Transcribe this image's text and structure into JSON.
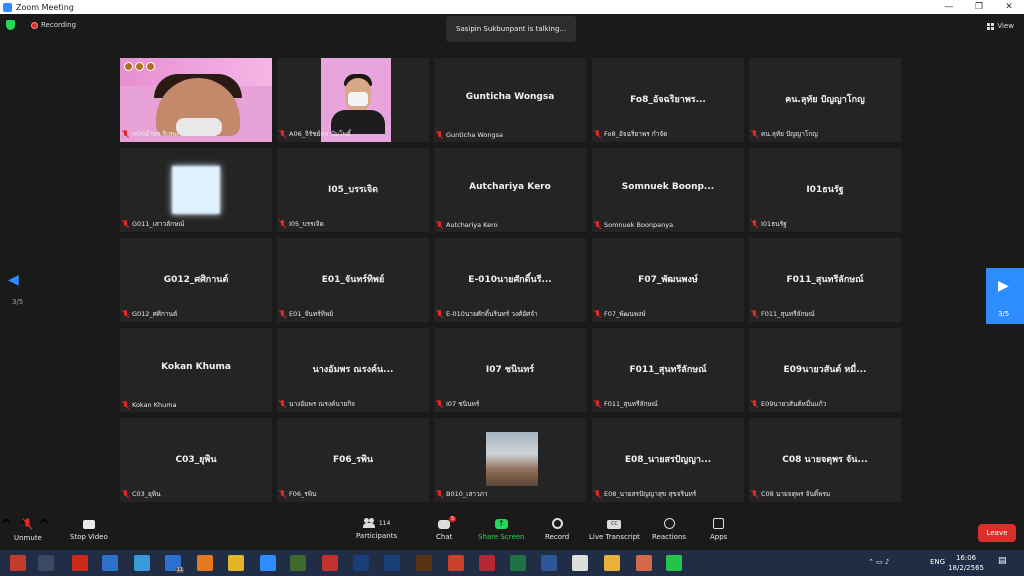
{
  "window": {
    "title": "Zoom Meeting"
  },
  "top": {
    "recording": "Recording",
    "talking": "Sasipin Sukbunpant is talking...",
    "view": "View"
  },
  "pager": {
    "left_page": "3/5",
    "right_page": "3/5"
  },
  "tiles": [
    {
      "name": "",
      "label": "H06อำพร ริเสพภัณีน์",
      "video": "woman"
    },
    {
      "name": "",
      "label": "A06_จิรัชย์ศล ปัมโพธิ์",
      "video": "man"
    },
    {
      "name": "Gunticha Wongsa",
      "label": "Gunticha Wongsa"
    },
    {
      "name": "Fo8_อัจฉริยาพร...",
      "label": "Fo8_อัจฉริยาพร กำจัด"
    },
    {
      "name": "ฅน.ลุทัย ปัญญาโกญ",
      "label": "ฅน.ลุทัย ปัญญาโกญ"
    },
    {
      "name": "",
      "label": "G011_เสาวลักษณ์",
      "video": "avatar"
    },
    {
      "name": "I05_บรรเจิด",
      "label": "I05_บรรเจิด"
    },
    {
      "name": "Autchariya Kero",
      "label": "Autchariya Kero"
    },
    {
      "name": "Somnuek Boonp...",
      "label": "Somnuek Boonpanya"
    },
    {
      "name": "I01ธนรัฐ",
      "label": "I01ธนรัฐ"
    },
    {
      "name": "G012_ศศิกานต์",
      "label": "G012_ศศิกานต์"
    },
    {
      "name": "E01_จันทร์ทิพย์",
      "label": "E01_จันทร์ทิพย์"
    },
    {
      "name": "E-010นายศักดิ์นรี...",
      "label": "E-010นายศักดิ์นรินทร์ วงศ์อัศจำ"
    },
    {
      "name": "F07_พัฒนพงษ์",
      "label": "F07_พัฒนพงษ์"
    },
    {
      "name": "F011_สุนทรีลักษณ์",
      "label": "F011_สุนทรีลักษณ์"
    },
    {
      "name": "Kokan Khuma",
      "label": "Kokan Khuma"
    },
    {
      "name": "นางอัมพร ณรงค์น...",
      "label": "นางอัมพร ณรงค์นายกิจ"
    },
    {
      "name": "I07 ชนินทร์",
      "label": "I07 ชนินทร์"
    },
    {
      "name": "F011_สุนทรีลักษณ์",
      "label": "F011_สุนทรีลักษณ์"
    },
    {
      "name": "E09นายวสันต์ หมื่...",
      "label": "E09นายวสันต์หมื่นแก้ว"
    },
    {
      "name": "C03_ยุพิน",
      "label": "C03_ยุพิน"
    },
    {
      "name": "F06_รพิน",
      "label": "F06_รพิน"
    },
    {
      "name": "",
      "label": "B010_เสาวภา",
      "video": "photo"
    },
    {
      "name": "E08_นายสรปัญญา...",
      "label": "E08_นายสรปัญญาสุข สุขจรินทร์"
    },
    {
      "name": "C08 นายจตุพร จัน...",
      "label": "C08 นายจตุพร จันติ์พรม"
    }
  ],
  "toolbar": {
    "unmute": "Unmute",
    "stop_video": "Stop Video",
    "participants": "Participants",
    "participants_count": "114",
    "chat": "Chat",
    "chat_badge": "5",
    "share_screen": "Share Screen",
    "record": "Record",
    "live_transcript": "Live Transcript",
    "reactions": "Reactions",
    "apps": "Apps",
    "leave": "Leave"
  },
  "taskbar": {
    "mail_badge": "11",
    "lang": "ENG",
    "time": "16:06",
    "date": "18/2/2565",
    "notif": "1"
  },
  "colors": {
    "accent": "#2d8cff",
    "danger": "#e02828",
    "share": "#23d959"
  }
}
